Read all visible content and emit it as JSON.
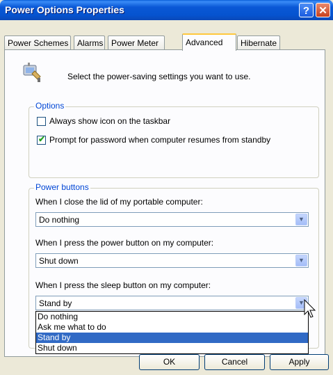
{
  "window": {
    "title": "Power Options Properties",
    "help_glyph": "?",
    "close_glyph": "✕"
  },
  "tabs": [
    {
      "label": "Power Schemes"
    },
    {
      "label": "Alarms"
    },
    {
      "label": "Power Meter"
    },
    {
      "label": "Advanced",
      "active": true
    },
    {
      "label": "Hibernate"
    }
  ],
  "intro": {
    "text": "Select the power-saving settings you want to use.",
    "icon": "power-plug-icon"
  },
  "options": {
    "label": "Options",
    "show_icon": {
      "label": "Always show icon on the taskbar",
      "checked": false
    },
    "prompt_password": {
      "label": "Prompt for password when computer resumes from standby",
      "checked": true
    }
  },
  "power_buttons": {
    "label": "Power buttons",
    "lid": {
      "label": "When I close the lid of my portable computer:",
      "value": "Do nothing"
    },
    "power": {
      "label": "When I press the power button on my computer:",
      "value": "Shut down"
    },
    "sleep": {
      "label": "When I press the sleep button on my computer:",
      "value": "Stand by",
      "options": [
        "Do nothing",
        "Ask me what to do",
        "Stand by",
        "Shut down"
      ]
    }
  },
  "buttons": {
    "ok": "OK",
    "cancel": "Cancel",
    "apply": "Apply"
  },
  "colors": {
    "title_bar": "#0a58d6",
    "group_label": "#0046d5",
    "selection": "#316ac5"
  }
}
